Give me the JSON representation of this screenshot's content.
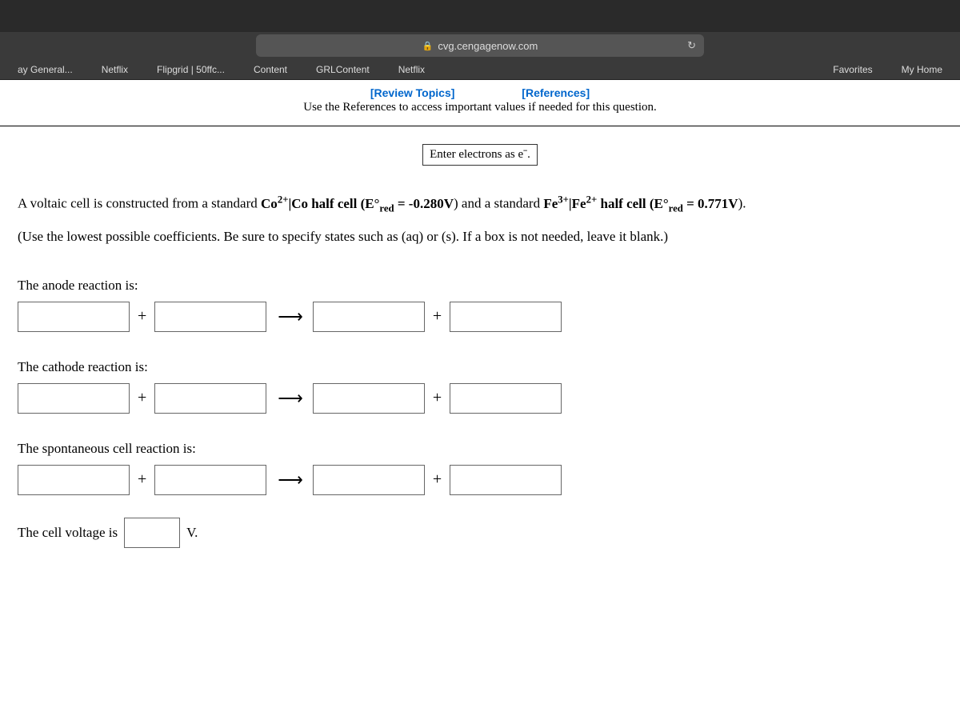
{
  "browser": {
    "url": "cvg.cengagenow.com",
    "bookmarks": [
      "ay General...",
      "Netflix",
      "Flipgrid | 50ffc...",
      "Content",
      "GRLContent",
      "Netflix",
      "Favorites",
      "My Home"
    ]
  },
  "toplinks": {
    "review": "[Review Topics]",
    "references": "[References]"
  },
  "subinstruction": "Use the References to access important values if needed for this question.",
  "hint": "Enter electrons as eˉ.",
  "question": {
    "line1_pre": "A voltaic cell is constructed from a standard ",
    "half1_species": "Co",
    "half1_sup": "2+",
    "half1_sep": "|Co half cell (E°",
    "half1_sub": "red",
    "half1_eq": " = ",
    "half1_val": "-0.280V",
    "line1_mid": ") and a standard ",
    "half2_species": "Fe",
    "half2_sup1": "3+",
    "half2_sep": "|Fe",
    "half2_sup2": "2+",
    "half2_tail": " half cell (E°",
    "half2_sub": "red",
    "half2_eq": " = ",
    "half2_val": "0.771V",
    "line1_end": ").",
    "line2": "(Use the lowest possible coefficients. Be sure to specify states such as (aq) or (s). If a box is not needed, leave it blank.)"
  },
  "sections": {
    "anode": "The anode reaction is:",
    "cathode": "The cathode reaction is:",
    "spontaneous": "The spontaneous cell reaction is:",
    "voltage_pre": "The cell voltage is",
    "voltage_unit": "V."
  },
  "symbols": {
    "plus": "+",
    "arrow": "⟶"
  }
}
